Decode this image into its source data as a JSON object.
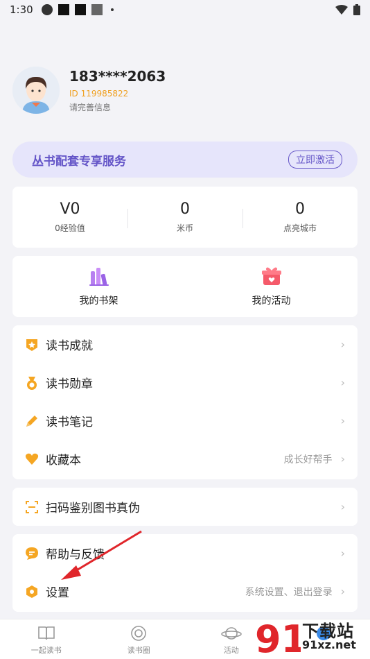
{
  "status_bar": {
    "time": "1:30"
  },
  "profile": {
    "phone": "183****2063",
    "id_text": "ID 119985822",
    "complete_info": "请完善信息"
  },
  "service": {
    "title": "丛书配套专享服务",
    "button": "立即激活"
  },
  "stats": [
    {
      "value": "V0",
      "label": "0经验值"
    },
    {
      "value": "0",
      "label": "米币"
    },
    {
      "value": "0",
      "label": "点亮城市"
    }
  ],
  "quick": [
    {
      "label": "我的书架",
      "icon": "bookshelf-icon"
    },
    {
      "label": "我的活动",
      "icon": "gift-icon"
    }
  ],
  "menu1": [
    {
      "label": "读书成就",
      "extra": "",
      "icon": "badge-icon"
    },
    {
      "label": "读书勋章",
      "extra": "",
      "icon": "medal-icon"
    },
    {
      "label": "读书笔记",
      "extra": "",
      "icon": "pencil-icon"
    },
    {
      "label": "收藏本",
      "extra": "成长好帮手",
      "icon": "heart-icon"
    }
  ],
  "menu2": [
    {
      "label": "扫码鉴别图书真伪",
      "icon": "scan-icon"
    }
  ],
  "menu3": [
    {
      "label": "帮助与反馈",
      "extra": "",
      "icon": "chat-icon"
    },
    {
      "label": "设置",
      "extra": "系统设置、退出登录",
      "icon": "settings-icon"
    }
  ],
  "bottom_nav": [
    {
      "label": "一起读书",
      "icon": "book-icon"
    },
    {
      "label": "读书圈",
      "icon": "circle-icon"
    },
    {
      "label": "活动",
      "icon": "planet-icon"
    },
    {
      "label": "",
      "icon": "profile-icon"
    }
  ],
  "watermark": {
    "logo": "91",
    "text": "下载站",
    "domain": "91xz.net"
  },
  "colors": {
    "accent": "#6556c8",
    "orange": "#f5a623",
    "banner_bg": "#e6e5fb"
  }
}
